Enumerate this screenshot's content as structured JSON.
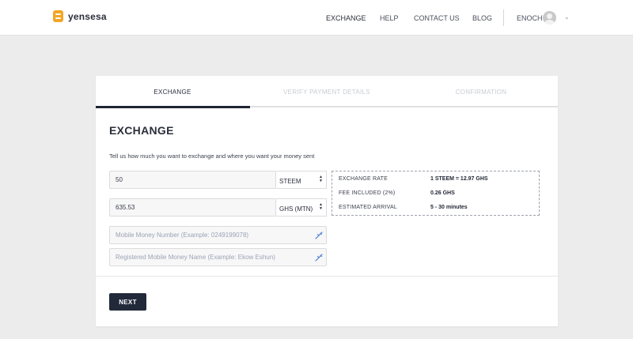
{
  "brand": {
    "name": "yensesa",
    "color": "#f2a626"
  },
  "nav": {
    "items": [
      {
        "label": "EXCHANGE",
        "active": true
      },
      {
        "label": "HELP"
      },
      {
        "label": "CONTACT US"
      },
      {
        "label": "BLOG"
      }
    ],
    "user": {
      "name": "ENOCH"
    }
  },
  "steps": [
    {
      "label": "EXCHANGE",
      "active": true
    },
    {
      "label": "VERIFY PAYMENT DETAILS"
    },
    {
      "label": "CONFIRMATION"
    }
  ],
  "form": {
    "title": "EXCHANGE",
    "subtitle": "Tell us how much you want to exchange and where you want your money sent",
    "send_amount": "50",
    "send_currency": "STEEM",
    "receive_amount": "635.53",
    "receive_currency": "GHS (MTN)",
    "mobile_number_placeholder": "Mobile Money Number (Example: 0249199078)",
    "mobile_name_placeholder": "Registered Mobile Money Name (Example: Ekow Eshun)",
    "next_label": "NEXT"
  },
  "rates": [
    {
      "label": "EXCHANGE RATE",
      "value": "1 STEEM = 12.97 GHS"
    },
    {
      "label": "FEE INCLUDED (2%)",
      "value": "0.26 GHS"
    },
    {
      "label": "ESTIMATED ARRIVAL",
      "value": "5 - 30 minutes"
    }
  ],
  "colors": {
    "primary": "#222a3a",
    "background": "#ececec"
  }
}
